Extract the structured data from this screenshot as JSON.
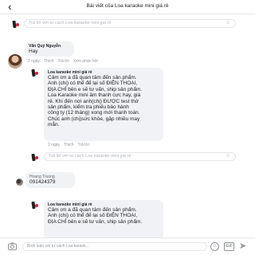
{
  "header": {
    "back_icon": "chevron-left-icon",
    "title": "Bài viết của Loa karaoke mini giá rẻ"
  },
  "reply_placeholder": "Trả lời với tư cách Loa karaoke mini giá rẻ",
  "comments": [
    {
      "author": "Văn Quý Nguyễn",
      "text": "Hay",
      "time": "2 ngày",
      "like": "Thích",
      "reply": "Trả lời",
      "view_replies": "Xem phản hồi"
    },
    {
      "author": "Loa karaoke mini giá rẻ",
      "lines": [
        "Cảm ơn a đã quan tâm đến sản phẩm.",
        "Anh (chị) có thể để lại số ĐIỆN THOẠI,",
        "ĐỊA CHỈ bên e sẽ tư vấn, ship sản phẩm.",
        "Loa Karaoke mini âm thanh cực hay, giá",
        "rẻ. Khi đến nơi anh(chị) ĐƯỢC test thử",
        "sản phẩm, kiểm tra phiếu bảo hành",
        "công ty (12 tháng) xong mới thanh toán.",
        "Chúc anh (chị)sức khỏe, gặp nhiều may",
        "mắn."
      ],
      "time": "2 ngày",
      "like": "Thích",
      "reply": "Trả lời"
    },
    {
      "author": "Hoang Truong",
      "text": "091424379"
    },
    {
      "author": "Loa karaoke mini giá rẻ",
      "lines": [
        "Cảm ơn a đã quan tâm đến sản phẩm.",
        "Anh (chị) có thể để lại số ĐIỆN THOẠI,",
        "ĐỊA CHỈ bên e sẽ tư vấn, ship sản phẩm."
      ]
    }
  ],
  "footer": {
    "placeholder": "Bình luận với tư cách Loa karaok...",
    "camera_icon": "camera-icon",
    "emoji_icon": "emoji-icon",
    "gif_label": "GIF",
    "send_icon": "send-icon"
  }
}
